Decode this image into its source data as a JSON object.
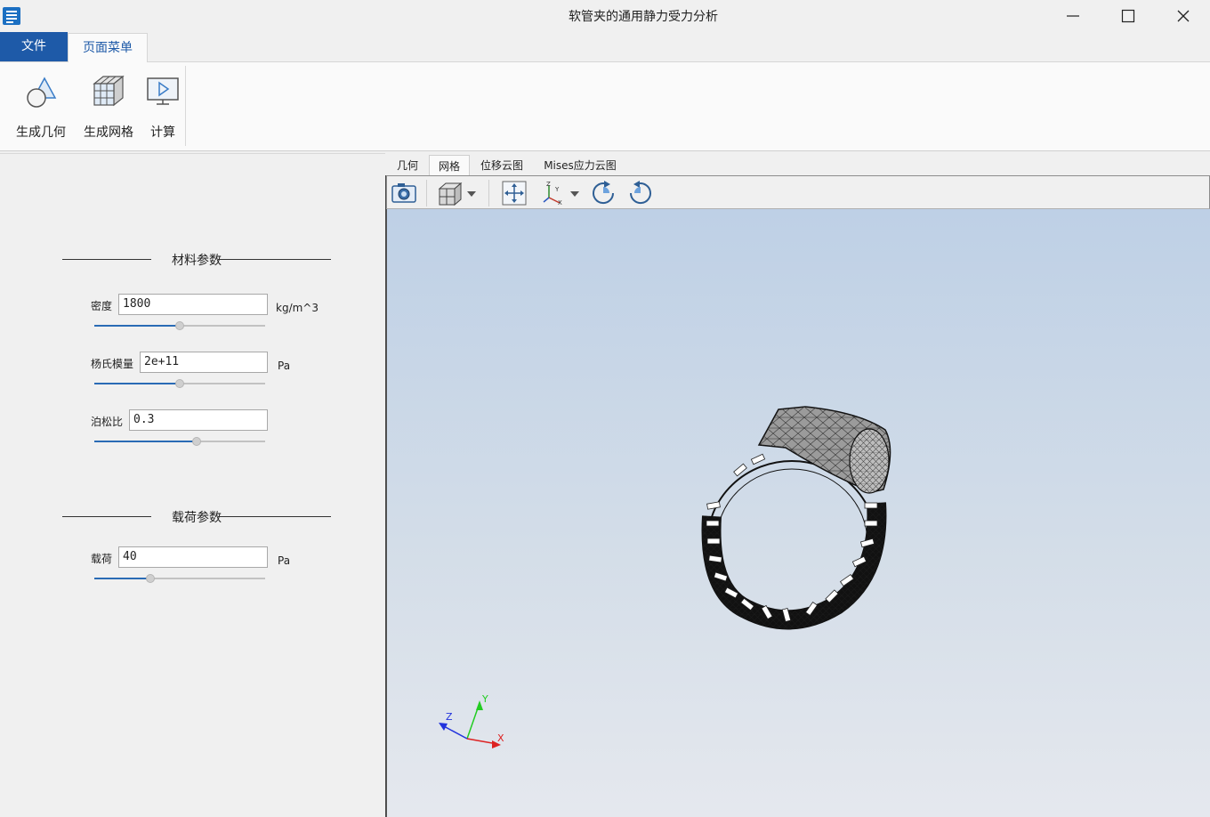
{
  "window": {
    "title": "软管夹的通用静力受力分析"
  },
  "menu": {
    "file_tab": "文件",
    "page_menu_tab": "页面菜单"
  },
  "ribbon": {
    "buttons": [
      {
        "label": "生成几何",
        "icon": "geometry-icon"
      },
      {
        "label": "生成网格",
        "icon": "mesh-icon"
      },
      {
        "label": "计算",
        "icon": "compute-icon"
      }
    ]
  },
  "material_section": {
    "title": "材料参数",
    "density": {
      "label": "密度",
      "value": "1800",
      "unit": "kg/m^3",
      "slider_fraction": 0.5
    },
    "youngs": {
      "label": "杨氏模量",
      "value": "2e+11",
      "unit": "Pa",
      "slider_fraction": 0.5
    },
    "poisson": {
      "label": "泊松比",
      "value": "0.3",
      "unit": "",
      "slider_fraction": 0.6
    }
  },
  "load_section": {
    "title": "载荷参数",
    "load": {
      "label": "载荷",
      "value": "40",
      "unit": "Pa",
      "slider_fraction": 0.33
    }
  },
  "view_tabs": [
    "几何",
    "网格",
    "位移云图",
    "Mises应力云图"
  ],
  "active_view_tab": "网格",
  "toolbar": {
    "icons": [
      "camera-icon",
      "view-cube-icon",
      "dropdown-arrow-icon",
      "fit-view-icon",
      "axes-icon",
      "dropdown-arrow-icon",
      "rotate-cw-icon",
      "rotate-ccw-icon"
    ]
  },
  "axes_triad": {
    "x": "X",
    "y": "Y",
    "z": "Z"
  },
  "colors": {
    "accent": "#1e5aa8",
    "viewport_top": "#bed0e6",
    "viewport_bottom": "#e5e8ee"
  }
}
